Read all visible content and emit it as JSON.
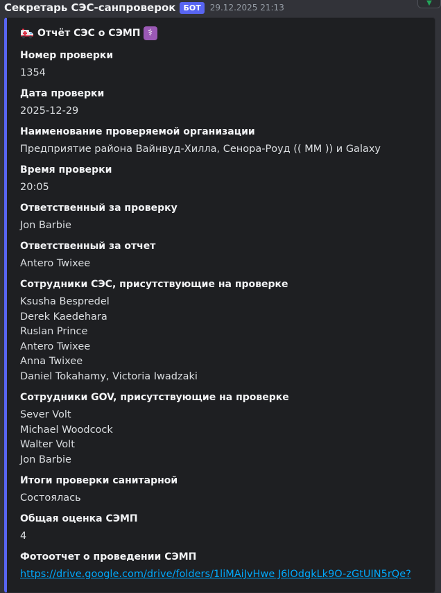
{
  "message": {
    "author": "Секретарь СЭС-санпроверок",
    "bot_badge": "БОТ",
    "timestamp": "29.12.2025 21:13",
    "hover_icon": "chevron-down-icon"
  },
  "embed": {
    "accent_color": "#5865f2",
    "title": "Отчёт СЭС о СЭМП",
    "title_icons": [
      "ambulance-icon",
      "medical-symbol-icon"
    ],
    "fields": [
      {
        "name": "Номер проверки",
        "lines": [
          "1354"
        ]
      },
      {
        "name": "Дата проверки",
        "lines": [
          "2025-12-29"
        ]
      },
      {
        "name": "Наименование проверяемой организации",
        "lines": [
          "Предприятие района Вайнвуд-Хилла, Сенора-Роуд (( ММ )) и Galaxy"
        ]
      },
      {
        "name": "Время проверки",
        "lines": [
          "20:05"
        ]
      },
      {
        "name": "Ответственный за проверку",
        "lines": [
          "Jon Barbie"
        ]
      },
      {
        "name": "Ответственный за отчет",
        "lines": [
          "Antero Twixee"
        ]
      },
      {
        "name": "Сотрудники СЭС, присутствующие на проверке",
        "lines": [
          "Ksusha Bespredel",
          "Derek Kaedehara",
          "Ruslan Prince",
          "Antero Twixee",
          "Anna Twixee",
          "Daniel Tokahamy, Victoria Iwadzaki"
        ]
      },
      {
        "name": "Сотрудники GOV, присутствующие на проверке",
        "lines": [
          "Sever Volt",
          "Michael Woodcock",
          "Walter Volt",
          "Jon Barbie"
        ]
      },
      {
        "name": "Итоги проверки санитарной",
        "lines": [
          "Состоялась"
        ]
      },
      {
        "name": "Общая оценка СЭМП",
        "lines": [
          "4"
        ]
      },
      {
        "name": "Фотоотчет о проведении СЭМП",
        "link": "https://drive.google.com/drive/folders/1liMAiJvHwe J6lOdgkLk9O-zGtUIN5rQe?"
      }
    ]
  }
}
